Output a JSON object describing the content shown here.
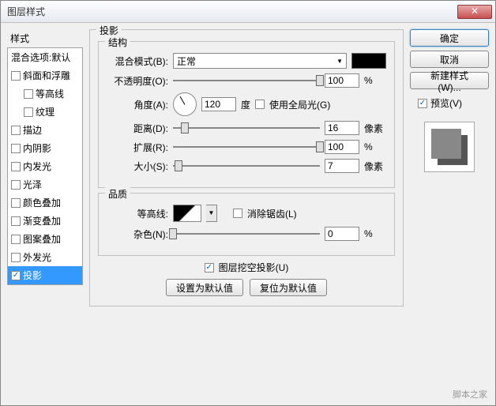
{
  "window": {
    "title": "图层样式"
  },
  "sidebar": {
    "header": "样式",
    "blendDefault": "混合选项:默认",
    "items": [
      {
        "label": "斜面和浮雕",
        "checked": false
      },
      {
        "label": "等高线",
        "checked": false,
        "indent": true
      },
      {
        "label": "纹理",
        "checked": false,
        "indent": true
      },
      {
        "label": "描边",
        "checked": false
      },
      {
        "label": "内阴影",
        "checked": false
      },
      {
        "label": "内发光",
        "checked": false
      },
      {
        "label": "光泽",
        "checked": false
      },
      {
        "label": "颜色叠加",
        "checked": false
      },
      {
        "label": "渐变叠加",
        "checked": false
      },
      {
        "label": "图案叠加",
        "checked": false
      },
      {
        "label": "外发光",
        "checked": false
      },
      {
        "label": "投影",
        "checked": true,
        "selected": true
      }
    ]
  },
  "panel": {
    "title": "投影",
    "structure": {
      "legend": "结构",
      "blendMode": {
        "label": "混合模式(B):",
        "value": "正常"
      },
      "opacity": {
        "label": "不透明度(O):",
        "value": "100",
        "unit": "%"
      },
      "angle": {
        "label": "角度(A):",
        "value": "120",
        "unit": "度",
        "globalLight": "使用全局光(G)",
        "globalChecked": false
      },
      "distance": {
        "label": "距离(D):",
        "value": "16",
        "unit": "像素"
      },
      "spread": {
        "label": "扩展(R):",
        "value": "100",
        "unit": "%"
      },
      "size": {
        "label": "大小(S):",
        "value": "7",
        "unit": "像素"
      }
    },
    "quality": {
      "legend": "品质",
      "contour": {
        "label": "等高线:",
        "antialias": "消除锯齿(L)",
        "antialiasChecked": false
      },
      "noise": {
        "label": "杂色(N):",
        "value": "0",
        "unit": "%"
      }
    },
    "knockout": {
      "label": "图层挖空投影(U)",
      "checked": true
    },
    "defaultBtns": {
      "set": "设置为默认值",
      "reset": "复位为默认值"
    }
  },
  "buttons": {
    "ok": "确定",
    "cancel": "取消",
    "newStyle": "新建样式(W)...",
    "preview": "预览(V)",
    "previewChecked": true
  },
  "watermark": "脚本之家"
}
